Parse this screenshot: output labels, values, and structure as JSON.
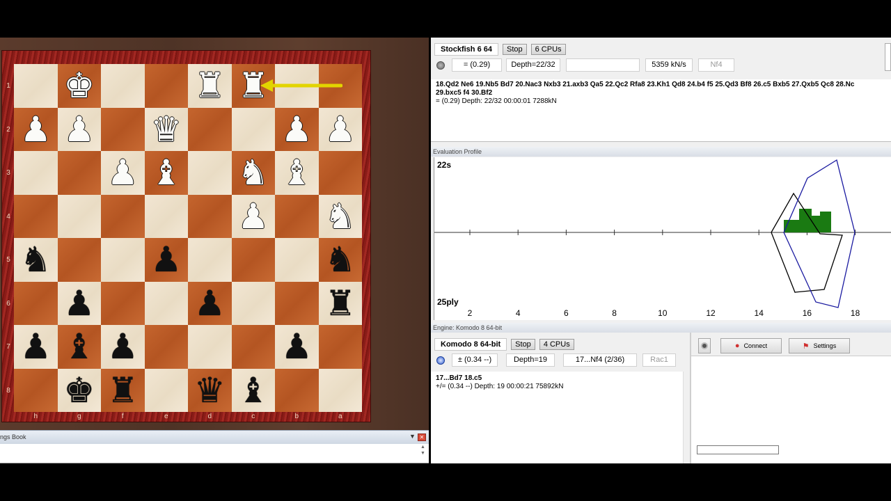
{
  "board": {
    "ranks": [
      "1",
      "2",
      "3",
      "4",
      "5",
      "6",
      "7",
      "8"
    ],
    "files": [
      "h",
      "g",
      "f",
      "e",
      "d",
      "c",
      "b",
      "a"
    ],
    "squares": [
      [
        "",
        "wK",
        "",
        "",
        "wR",
        "wR",
        "",
        ""
      ],
      [
        "wP",
        "wP",
        "",
        "wQ",
        "",
        "",
        "wP",
        "wP"
      ],
      [
        "",
        "",
        "wP",
        "wB",
        "",
        "wN",
        "wB",
        ""
      ],
      [
        "",
        "",
        "",
        "",
        "",
        "wP",
        "",
        "wN"
      ],
      [
        "bN",
        "",
        "",
        "bP",
        "",
        "",
        "",
        "bN"
      ],
      [
        "",
        "bP",
        "",
        "",
        "bP",
        "",
        "",
        "bR"
      ],
      [
        "bP",
        "bB",
        "bP",
        "",
        "",
        "",
        "bP",
        ""
      ],
      [
        "",
        "bK",
        "bR",
        "",
        "bQ",
        "bB",
        "",
        ""
      ]
    ],
    "arrow_color": "#e2d400"
  },
  "openings_book": {
    "title": "ngs Book"
  },
  "stockfish": {
    "name": "Stockfish 6 64",
    "stop_label": "Stop",
    "cpus_label": "6 CPUs",
    "eval": "= (0.29)",
    "depth": "Depth=22/32",
    "speed": "5359 kN/s",
    "current_move": "Nf4",
    "pv": "18.Qd2 Ne6 19.Nb5 Bd7 20.Nac3 Nxb3 21.axb3 Qa5 22.Qc2 Rfa8 23.Kh1 Qd8 24.b4 f5 25.Qd3 Bf8 26.c5 Bxb5 27.Qxb5 Qc8 28.Nc",
    "pv_cont": "29.bxc5 f4 30.Bf2",
    "info": "=  (0.29)    Depth: 22/32    00:00:01   7288kN"
  },
  "eval_profile": {
    "title": "Evaluation Profile",
    "time_label": "22s",
    "ply_label": "25ply",
    "x_ticks": [
      "2",
      "4",
      "6",
      "8",
      "10",
      "12",
      "14",
      "16",
      "18"
    ],
    "colors": {
      "bar": "#1a7a12",
      "engine1": "#000000",
      "engine2": "#1a1aa0"
    }
  },
  "komodo": {
    "strip_title": "Engine: Komodo 8 64-bit",
    "name": "Komodo 8 64-bit",
    "stop_label": "Stop",
    "cpus_label": "4 CPUs",
    "eval": "±  (0.34 --)",
    "depth": "Depth=19",
    "current_move": "17...Nf4 (2/36)",
    "last_move": "Rac1",
    "pv": "17...Bd7 18.c5",
    "info": "+/=   (0.34 --)    Depth: 19   00:00:21   75892kN"
  },
  "side_toolbar": {
    "connect_label": "Connect",
    "settings_label": "Settings"
  }
}
